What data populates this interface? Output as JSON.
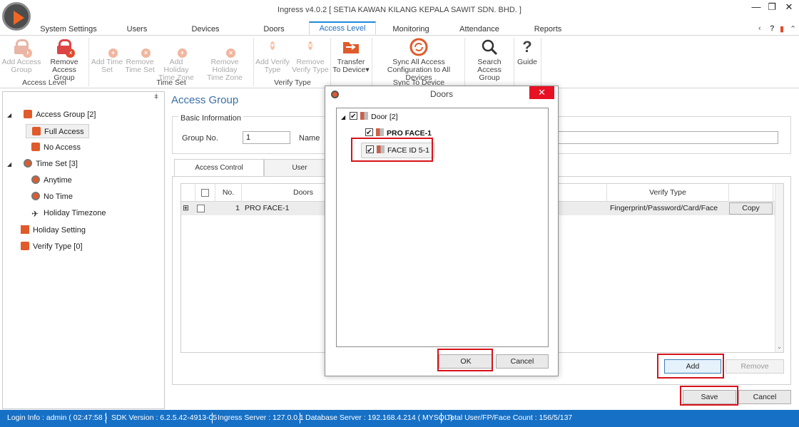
{
  "window": {
    "title": "Ingress v4.0.2 [ SETIA KAWAN KILANG KEPALA SAWIT SDN. BHD. ]",
    "controls": {
      "minimize": "—",
      "restore": "❐",
      "close": "✕"
    },
    "ribbon_right": {
      "collapse": "‹",
      "help": "?",
      "office": "▮",
      "expand": "⌃"
    }
  },
  "ribbon_tabs": [
    {
      "label": "System Settings"
    },
    {
      "label": "Users"
    },
    {
      "label": "Devices"
    },
    {
      "label": "Doors"
    },
    {
      "label": "Access Level",
      "active": true
    },
    {
      "label": "Monitoring"
    },
    {
      "label": "Attendance"
    },
    {
      "label": "Reports"
    }
  ],
  "ribbon": {
    "access_level": {
      "caption": "Access Level",
      "add_access_group": [
        "Add Access",
        "Group"
      ],
      "remove_access_group": [
        "Remove",
        "Access Group"
      ]
    },
    "time_set": {
      "caption": "Time Set",
      "add_time_set": [
        "Add Time",
        "Set"
      ],
      "remove_time_set": [
        "Remove",
        "Time Set"
      ],
      "add_holiday_time_zone": [
        "Add Holiday",
        "Time Zone"
      ],
      "remove_holiday_time_zone": [
        "Remove Holiday",
        "Time Zone"
      ]
    },
    "verify_type": {
      "caption": "Verify Type",
      "add_verify_type": [
        "Add Verify",
        "Type"
      ],
      "remove_verify_type": [
        "Remove",
        "Verify Type"
      ]
    },
    "transfer": {
      "line1": "Transfer",
      "line2": "To Device",
      "arrow": "▾"
    },
    "sync": {
      "caption": "Sync To Device",
      "line1": "Sync All Access",
      "line2": "Configuration to All Devices"
    },
    "search": {
      "line1": "Search",
      "line2": "Access Group"
    },
    "guide": {
      "icon": "?",
      "label": "Guide"
    }
  },
  "left_panel": {
    "pin": "ǂ",
    "tree": [
      {
        "label": "Access Group [2]",
        "expander": "◢",
        "icon": "lock-icon"
      },
      {
        "label": "Full Access",
        "icon": "lock-icon",
        "selected": true
      },
      {
        "label": "No Access",
        "icon": "lock-icon"
      },
      {
        "label": "Time Set [3]",
        "expander": "◢",
        "icon": "clock-icon"
      },
      {
        "label": "Anytime",
        "icon": "clock-icon"
      },
      {
        "label": "No Time",
        "icon": "clock-icon"
      },
      {
        "label": "Holiday Timezone",
        "icon": "airplane-icon"
      },
      {
        "label": "Holiday Setting",
        "icon": "calendar-icon"
      },
      {
        "label": "Verify Type [0]",
        "icon": "checkbox-icon"
      }
    ]
  },
  "main": {
    "title": "Access Group",
    "basic_info": {
      "legend": "Basic Information",
      "group_no_label": "Group No.",
      "group_no_value": "1",
      "name_label": "Name",
      "name_value": ""
    },
    "tabs": [
      {
        "label": "Access Control",
        "active": true
      },
      {
        "label": "User"
      }
    ],
    "grid": {
      "columns": [
        "",
        "No.",
        "Doors",
        "Verify Type",
        ""
      ],
      "rows": [
        {
          "expander": "⊞",
          "no": "1",
          "door": "PRO FACE-1",
          "verify_type": "Fingerprint/Password/Card/Face",
          "action": "Copy"
        }
      ],
      "scroll_down": "⌄"
    },
    "buttons": {
      "add": "Add",
      "remove": "Remove",
      "save": "Save",
      "cancel": "Cancel"
    }
  },
  "doors_dialog": {
    "title": "Doors",
    "close": "✕",
    "tree": {
      "root": {
        "label": "Door [2]",
        "expander": "◢",
        "checked": true
      },
      "children": [
        {
          "label": "PRO FACE-1",
          "checked": true,
          "bold": true
        },
        {
          "label": "FACE ID 5-1",
          "checked": true,
          "focused": true
        }
      ]
    },
    "ok": "OK",
    "cancel": "Cancel"
  },
  "status_bar": {
    "login": "Login Info : admin ( 02:47:58 )",
    "sdk": "SDK Version : 6.2.5.42-4913-05",
    "ingress_server": "Ingress Server : 127.0.0.1",
    "database_server": "Database Server : 192.168.4.214 ( MYSQL )",
    "counts": "Total User/FP/Face Count : 156/5/137"
  },
  "colors": {
    "accent": "#1e6fc0",
    "status_bar": "#1670c6",
    "highlight_box": "#d8121a",
    "close_button": "#e81123",
    "icon_orange": "#e05a2b"
  }
}
